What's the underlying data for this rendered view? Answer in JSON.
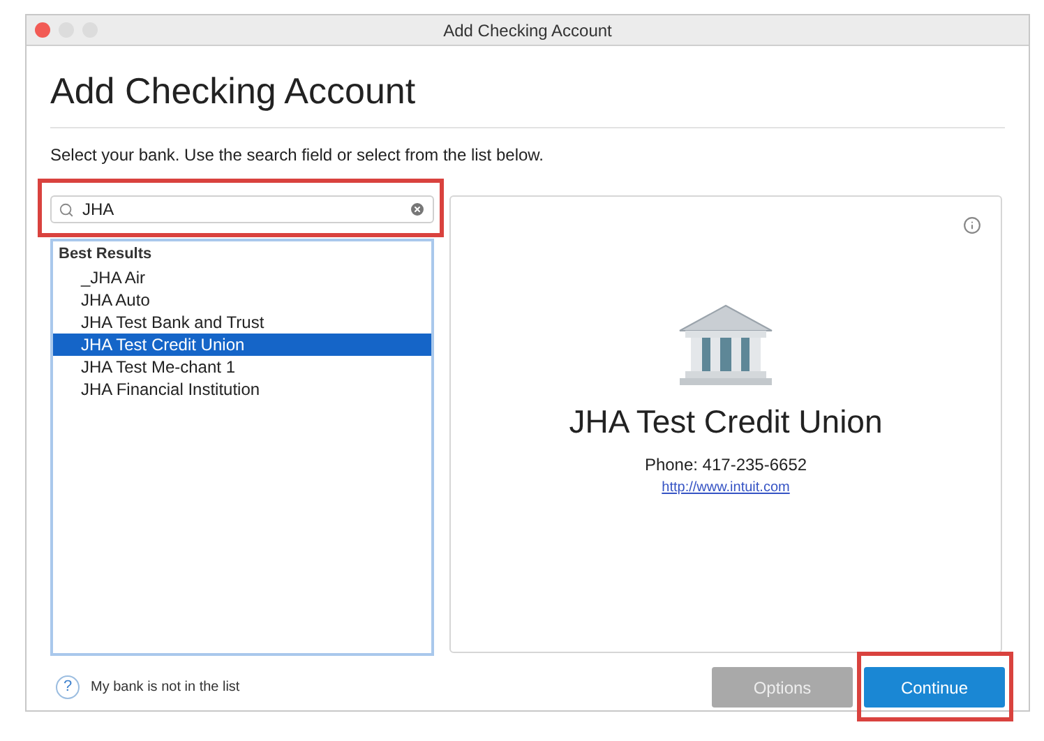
{
  "window": {
    "title": "Add Checking Account"
  },
  "heading": "Add Checking Account",
  "instruction": "Select your bank. Use the search field or select from the list below.",
  "search": {
    "value": "JHA",
    "highlighted": true
  },
  "results": {
    "group": "Best Results",
    "items": [
      {
        "label": "_JHA Air",
        "selected": false
      },
      {
        "label": "JHA Auto",
        "selected": false
      },
      {
        "label": "JHA Test Bank and Trust",
        "selected": false
      },
      {
        "label": "JHA Test Credit Union",
        "selected": true
      },
      {
        "label": "JHA Test Me-chant 1",
        "selected": false
      },
      {
        "label": "JHA Financial Institution",
        "selected": false
      }
    ]
  },
  "detail": {
    "name": "JHA Test Credit Union",
    "phone": "Phone: 417-235-6652",
    "url": "http://www.intuit.com"
  },
  "help": {
    "icon": "?",
    "label": "My bank is not in the list"
  },
  "buttons": [
    {
      "label": "Options",
      "disabled": true,
      "highlighted": false
    },
    {
      "label": "Continue",
      "disabled": false,
      "highlighted": true
    }
  ]
}
